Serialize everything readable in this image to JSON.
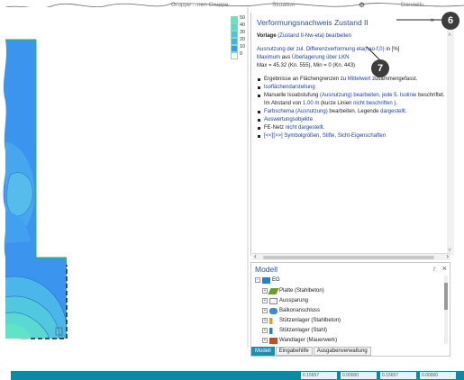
{
  "toolbar": {
    "fragment_left": "Gruppe",
    "fragment_left2": "...nen Gruppe",
    "fragment_mid": "Situation",
    "fragment_right": "Darstellu..."
  },
  "legend": {
    "values": [
      "50",
      "40",
      "30",
      "20",
      "10",
      "0"
    ],
    "colors": [
      "#5fe4c6",
      "#59d6d4",
      "#4fc2e0",
      "#45aef0",
      "#3a9af2",
      "#ffffff"
    ]
  },
  "info": {
    "title": "Verformungsnachweis Zustand II",
    "close_glyph": "×",
    "vorlage_label": "Vorlage",
    "vorlage_link": "(Zustand II-Nw-eta)",
    "vorlage_rest": "bearbeiten",
    "line1_a": "Ausnutzung der zul. Differenzverformung",
    "line1_b": "eta(f,ao-f,0)",
    "line1_c": "in [%]",
    "line2_a": "Maximum",
    "line2_b": "aus",
    "line2_c": "Überlagerung über LKN",
    "line3": "Max = 45.32 (Kn. 555), Min = 0 (Kn. 443)",
    "b1_a": "Ergebnisse an Flächengrenzen zu",
    "b1_b": "Mittelwert",
    "b1_c": "zusammengefasst.",
    "b2": "Isoflächendarstellung",
    "b3_a": "Manuelle Isoabstufung",
    "b3_b": "(Ausnutzung)",
    "b3_c": "bearbeiten, jede 5. Isolinie",
    "b3_d": "beschriftet. Im Abstand von",
    "b3_e": "1.00 m",
    "b3_f": "(kurze Linien",
    "b3_g": "nicht beschriften",
    "b3_h": ").",
    "b4_a": "Farbschema",
    "b4_b": "(Ausnutzung)",
    "b4_c": "bearbeiten. Legende",
    "b4_d": "dargestellt.",
    "b5": "Auswertungsobjekte",
    "b6_a": "FE-Netz",
    "b6_b": "nicht dargestellt.",
    "b7": "[<<][>>] Symbolgrößen, Stifte, Sicht-Eigenschaften"
  },
  "modell": {
    "title": "Modell",
    "pin_glyph": "♇",
    "close_glyph": "×",
    "tree": [
      {
        "label": "EG",
        "icon": "folder-icon",
        "color": "#2a7fd4",
        "level": 0,
        "expander": "−"
      },
      {
        "label": "Platte (Stahlbeton)",
        "icon": "slab-icon",
        "color": "#6a9f2a",
        "level": 1,
        "expander": "+"
      },
      {
        "label": "Aussparung",
        "icon": "opening-icon",
        "color": "#888888",
        "level": 1,
        "expander": "+"
      },
      {
        "label": "Balkonanschluss",
        "icon": "balcony-connector-icon",
        "color": "#3a8ad8",
        "level": 1,
        "expander": "+"
      },
      {
        "label": "Stützenlager (Stahlbeton)",
        "icon": "column-support-icon",
        "color": "#e0a020",
        "level": 1,
        "expander": "+"
      },
      {
        "label": "Stützenlager (Stahl)",
        "icon": "steel-column-icon",
        "color": "#2a7fd4",
        "level": 1,
        "expander": "+"
      },
      {
        "label": "Wandlager (Mauerwerk)",
        "icon": "wall-support-icon",
        "color": "#c84a20",
        "level": 1,
        "expander": "+"
      }
    ],
    "tabs": [
      "Modell",
      "Eingabehilfe",
      "Ausgabenverwaltung"
    ]
  },
  "statusbar": {
    "fields": [
      "0.15657",
      "0.00000",
      "0.15657",
      "0.00000"
    ]
  },
  "callouts": {
    "six": "6",
    "seven": "7"
  },
  "colors": {
    "accent": "#2b4fa6",
    "link": "#1a3db8",
    "status": "#0d8aa3",
    "iso_low": "#3a9af2",
    "iso_high": "#5fe4c6"
  }
}
